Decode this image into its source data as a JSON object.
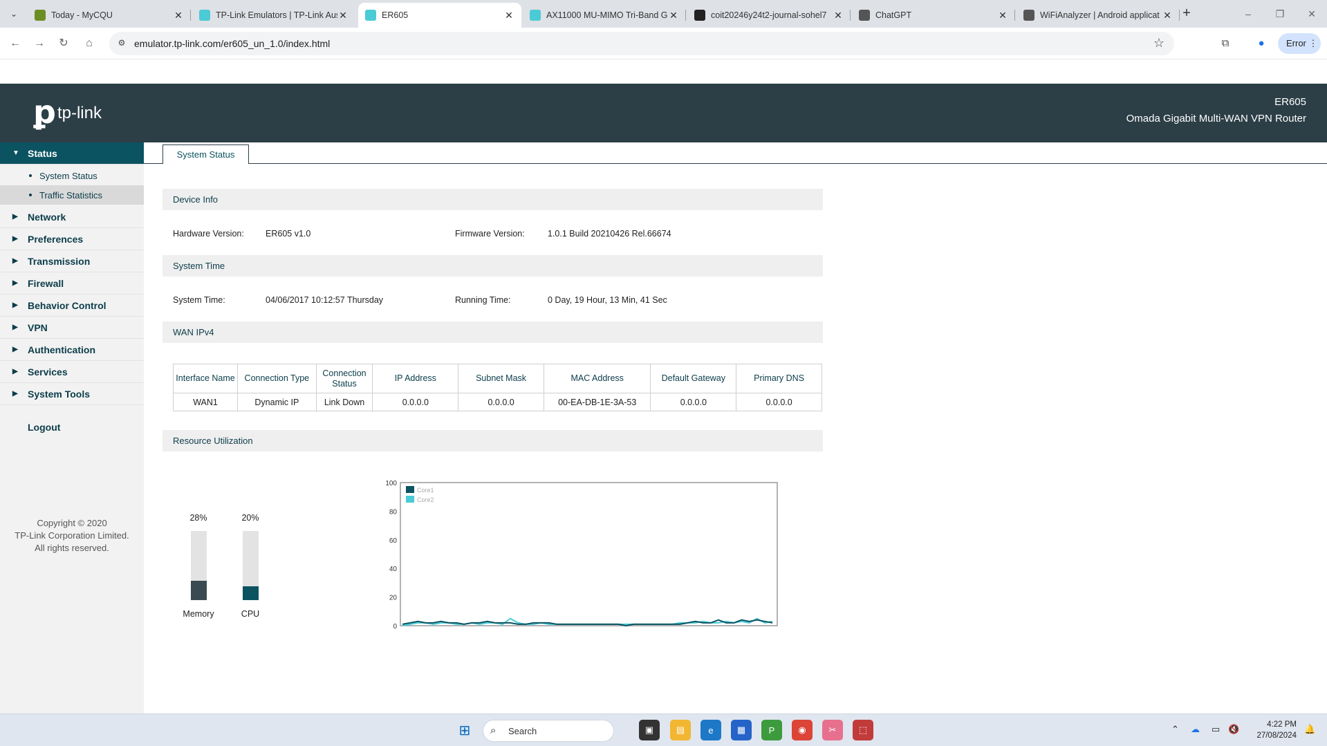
{
  "browser": {
    "tabs": [
      {
        "title": "Today - MyCQU",
        "icon": "mycqu-favicon",
        "color": "#6b8e23"
      },
      {
        "title": "TP-Link Emulators | TP-Link Aus",
        "icon": "tplink-favicon",
        "color": "#4acbd6"
      },
      {
        "title": "ER605",
        "icon": "tplink-favicon",
        "color": "#4acbd6"
      },
      {
        "title": "AX11000 MU-MIMO Tri-Band G",
        "icon": "tplink-favicon",
        "color": "#4acbd6"
      },
      {
        "title": "coit20246y24t2-journal-sohel7",
        "icon": "github-icon",
        "color": "#222"
      },
      {
        "title": "ChatGPT",
        "icon": "chatgpt-icon",
        "color": "#555"
      },
      {
        "title": "WiFiAnalyzer | Android applicat",
        "icon": "globe-icon",
        "color": "#555"
      }
    ],
    "active_tab": 2,
    "url": "emulator.tp-link.com/er605_un_1.0/index.html",
    "error_label": "Error"
  },
  "header": {
    "brand": "tp-link",
    "model": "ER605",
    "model_desc": "Omada Gigabit Multi-WAN VPN Router"
  },
  "sidebar": {
    "menu": [
      {
        "label": "Status",
        "expanded": true,
        "sub": [
          "System Status",
          "Traffic Statistics"
        ]
      },
      {
        "label": "Network"
      },
      {
        "label": "Preferences"
      },
      {
        "label": "Transmission"
      },
      {
        "label": "Firewall"
      },
      {
        "label": "Behavior Control"
      },
      {
        "label": "VPN"
      },
      {
        "label": "Authentication"
      },
      {
        "label": "Services"
      },
      {
        "label": "System Tools"
      }
    ],
    "logout": "Logout",
    "copyright": [
      "Copyright © 2020",
      "TP-Link Corporation Limited.",
      "All rights reserved."
    ]
  },
  "main": {
    "tab": "System Status",
    "device_info": {
      "title": "Device Info",
      "hardware_label": "Hardware Version:",
      "hardware_value": "ER605 v1.0",
      "firmware_label": "Firmware Version:",
      "firmware_value": "1.0.1 Build 20210426 Rel.66674"
    },
    "system_time": {
      "title": "System Time",
      "time_label": "System Time:",
      "time_value": "04/06/2017 10:12:57 Thursday",
      "running_label": "Running Time:",
      "running_value": "0 Day, 19 Hour, 13 Min, 41 Sec"
    },
    "wan": {
      "title": "WAN IPv4",
      "headers": [
        "Interface Name",
        "Connection Type",
        "Connection Status",
        "IP Address",
        "Subnet Mask",
        "MAC Address",
        "Default Gateway",
        "Primary DNS"
      ],
      "rows": [
        [
          "WAN1",
          "Dynamic IP",
          "Link Down",
          "0.0.0.0",
          "0.0.0.0",
          "00-EA-DB-1E-3A-53",
          "0.0.0.0",
          "0.0.0.0"
        ]
      ]
    },
    "resources": {
      "title": "Resource Utilization",
      "memory": {
        "label": "Memory",
        "percent_text": "28%",
        "percent": 28,
        "color": "#3a4a52"
      },
      "cpu": {
        "label": "CPU",
        "percent_text": "20%",
        "percent": 20,
        "color": "#0b5361"
      }
    }
  },
  "chart_data": {
    "type": "line",
    "ylim": [
      0,
      100
    ],
    "yticks": [
      0,
      20,
      40,
      60,
      80,
      100
    ],
    "legend_position": "top-left",
    "grid": false,
    "series": [
      {
        "name": "Core1",
        "color": "#0b5361",
        "values": [
          1,
          2,
          3,
          2,
          2,
          3,
          2,
          2,
          1,
          2,
          2,
          3,
          2,
          2,
          2,
          1,
          1,
          2,
          2,
          2,
          1,
          1,
          1,
          1,
          1,
          1,
          1,
          1,
          1,
          0,
          1,
          1,
          1,
          1,
          1,
          1,
          1,
          2,
          3,
          2,
          2,
          4,
          2,
          2,
          4,
          3,
          4,
          3,
          2
        ]
      },
      {
        "name": "Core2",
        "color": "#4acbd6",
        "values": [
          0,
          1,
          2,
          2,
          1,
          2,
          2,
          1,
          1,
          2,
          1,
          2,
          2,
          1,
          5,
          2,
          1,
          1,
          2,
          1,
          1,
          1,
          1,
          1,
          1,
          1,
          1,
          1,
          1,
          1,
          1,
          1,
          1,
          1,
          1,
          1,
          2,
          2,
          2,
          3,
          2,
          2,
          3,
          2,
          3,
          2,
          5,
          2,
          3
        ]
      }
    ]
  },
  "taskbar": {
    "search_placeholder": "Search",
    "time": "4:22 PM",
    "date": "27/08/2024"
  }
}
